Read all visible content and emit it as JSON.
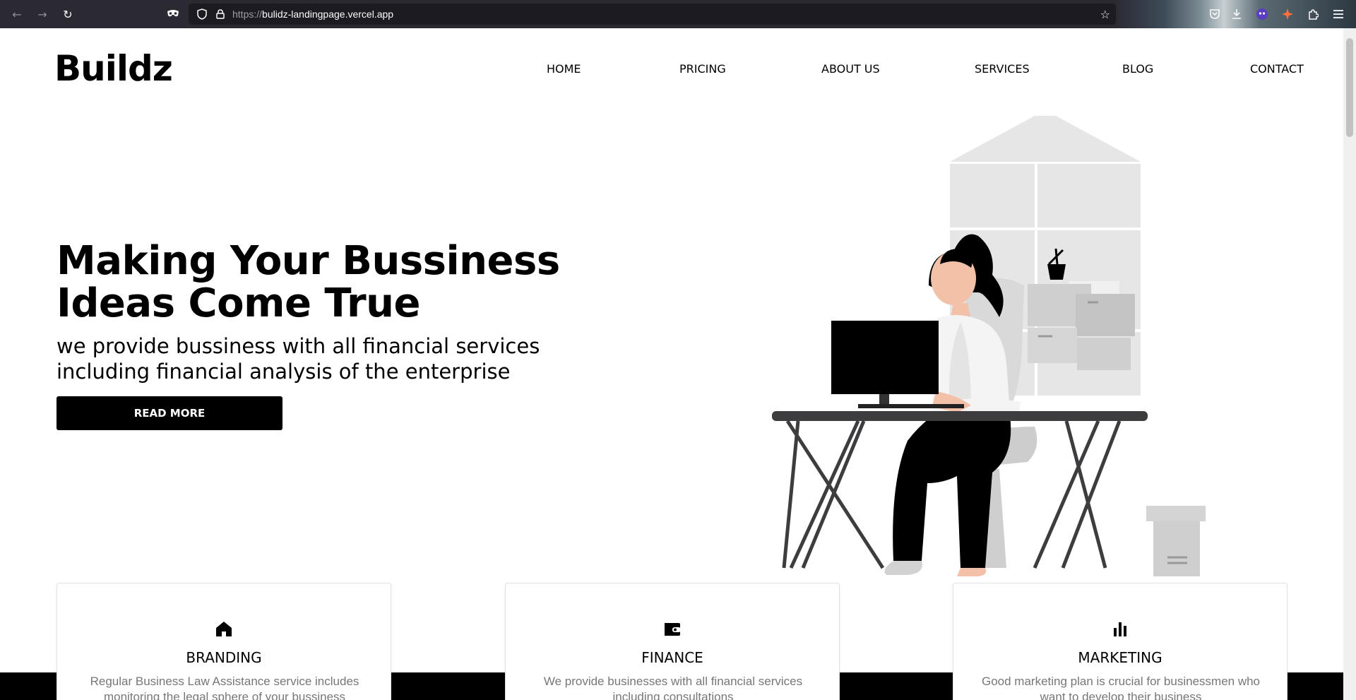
{
  "browser": {
    "url_protocol": "https://",
    "url_host": "bulidz-landingpage.vercel.app",
    "icons": [
      "back-arrow-icon",
      "forward-arrow-icon",
      "reload-icon",
      "private-mask-icon",
      "shield-icon",
      "lock-icon",
      "bookmark-star-icon",
      "pocket-icon",
      "download-icon",
      "extension-avatar-icon",
      "extension-spark-icon",
      "extensions-puzzle-icon",
      "menu-icon"
    ]
  },
  "header": {
    "logo": "Buildz",
    "nav": [
      "HOME",
      "PRICING",
      "ABOUT US",
      "SERVICES",
      "BLOG",
      "CONTACT"
    ]
  },
  "hero": {
    "title": "Making Your Bussiness Ideas Come True",
    "subtitle": "we provide bussiness with all financial services including financial analysis of the enterprise",
    "cta_label": "READ MORE"
  },
  "services": [
    {
      "icon": "home-icon",
      "title": "BRANDING",
      "text": "Regular Business Law Assistance service includes monitoring the legal sphere of your bussiness"
    },
    {
      "icon": "wallet-icon",
      "title": "FINANCE",
      "text": "We provide businesses with all financial services including consultations"
    },
    {
      "icon": "bar-chart-icon",
      "title": "MARKETING",
      "text": "Good marketing plan is crucial for businessmen who want to develop their business"
    }
  ],
  "colors": {
    "primary": "#000000",
    "muted_text": "#777777",
    "illustration_gray": "#e6e6e6"
  }
}
